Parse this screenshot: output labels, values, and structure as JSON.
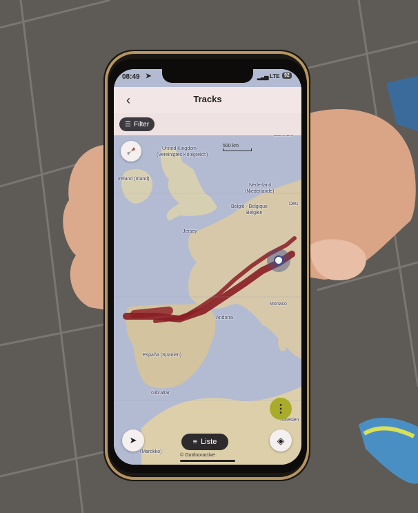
{
  "status_bar": {
    "time": "08:49",
    "network": "LTE",
    "battery": "92"
  },
  "nav": {
    "title": "Tracks"
  },
  "filter": {
    "label": "Filter"
  },
  "map": {
    "scale_label": "500 km",
    "place_labels": [
      "United Kingdom",
      "(Vereinigtes Königreich)",
      "Ireland (Irland)",
      "Nederland",
      "(Niederlande)",
      "België - Belgique",
      "Belgien",
      "Jersey",
      "Danmark",
      "Deu",
      "Andorra",
      "Monaco",
      "España (Spanien)",
      "Gibraltar",
      "Tunesien",
      "(Marokko)"
    ],
    "attribution": "© Outdooractive"
  },
  "list_button": {
    "label": "Liste"
  },
  "colors": {
    "track": "#8a1d24",
    "accent": "#a8ac2a",
    "sea": "#b3bbd2",
    "land": "#d6c8a8"
  },
  "icons": [
    "back-chevron-icon",
    "filter-icon",
    "compass-icon",
    "more-icon",
    "layers-icon",
    "location-arrow-icon",
    "list-icon",
    "location-marker-icon"
  ]
}
